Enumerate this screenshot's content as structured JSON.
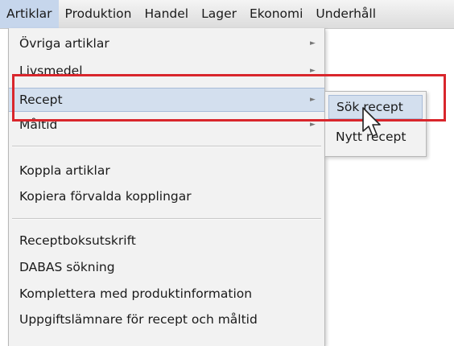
{
  "menubar": {
    "items": [
      "Artiklar",
      "Produktion",
      "Handel",
      "Lager",
      "Ekonomi",
      "Underhåll"
    ]
  },
  "dropdown": {
    "group1": [
      {
        "label": "Övriga artiklar",
        "has_submenu": true
      },
      {
        "label": "Livsmedel",
        "has_submenu": true
      },
      {
        "label": "Recept",
        "has_submenu": true
      },
      {
        "label": "Måltid",
        "has_submenu": true
      }
    ],
    "group2": [
      {
        "label": "Koppla artiklar"
      },
      {
        "label": "Kopiera förvalda kopplingar"
      }
    ],
    "group3": [
      {
        "label": "Receptboksutskrift"
      },
      {
        "label": "DABAS sökning"
      },
      {
        "label": "Komplettera med produktinformation"
      },
      {
        "label": "Uppgiftslämnare för recept och måltid"
      }
    ],
    "arrow_glyph": "►"
  },
  "submenu": {
    "items": [
      "Sök recept",
      "Nytt recept"
    ]
  },
  "colors": {
    "highlight": "#d3dfee",
    "annotation_box": "#d9262c"
  },
  "icons": {
    "cursor": "mouse-pointer-icon",
    "submenu_arrow": "chevron-right-icon"
  }
}
